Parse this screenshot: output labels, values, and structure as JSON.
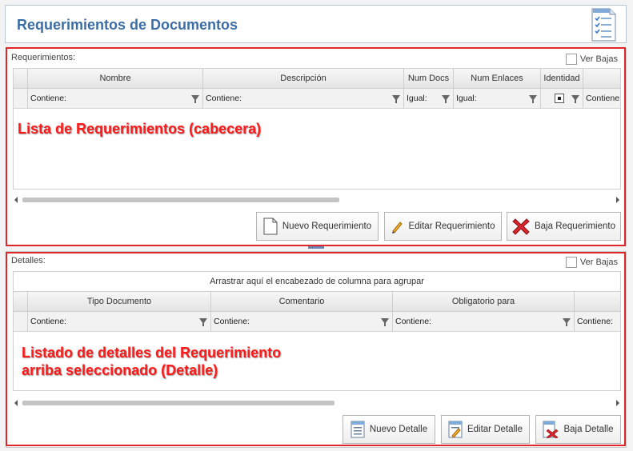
{
  "header": {
    "title": "Requerimientos de Documentos",
    "icon": "document-list-icon"
  },
  "requerimientos": {
    "label": "Requerimientos:",
    "ver_bajas": "Ver Bajas",
    "columns": [
      {
        "label": "Nombre",
        "filter": "Contiene:"
      },
      {
        "label": "Descripción",
        "filter": "Contiene:"
      },
      {
        "label": "Num Docs",
        "filter": "Igual:"
      },
      {
        "label": "Num Enlaces",
        "filter": "Igual:"
      },
      {
        "label": "Identidad",
        "filter": ""
      },
      {
        "label": "",
        "filter": "Contiene:"
      }
    ],
    "buttons": {
      "nuevo": "Nuevo Requerimiento",
      "editar": "Editar Requerimiento",
      "baja": "Baja Requerimiento"
    }
  },
  "detalles": {
    "label": "Detalles:",
    "ver_bajas": "Ver Bajas",
    "group_bar": "Arrastrar aquí el encabezado de columna para agrupar",
    "columns": [
      {
        "label": "Tipo Documento",
        "filter": "Contiene:"
      },
      {
        "label": "Comentario",
        "filter": "Contiene:"
      },
      {
        "label": "Obligatorio para",
        "filter": "Contiene:"
      },
      {
        "label": "",
        "filter": "Contiene:"
      }
    ],
    "buttons": {
      "nuevo": "Nuevo Detalle",
      "editar": "Editar Detalle",
      "baja": "Baja Detalle"
    }
  },
  "annotations": {
    "cabecera": "Lista de Requerimientos (cabecera)",
    "detalle_line1": "Listado de detalles del Requerimiento",
    "detalle_line2": "arriba seleccionado (Detalle)"
  },
  "colors": {
    "title": "#3c6ea5",
    "annotation": "#ff1a1a",
    "highlight_border": "#e0262a"
  }
}
